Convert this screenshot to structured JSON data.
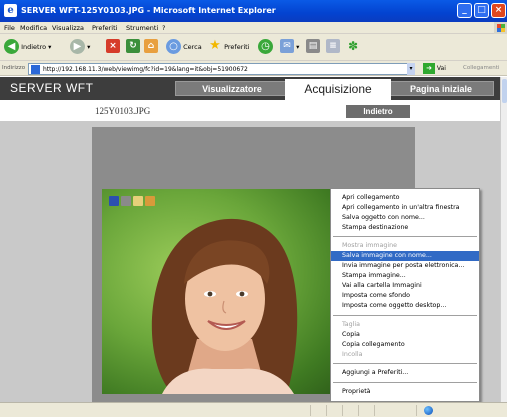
{
  "window": {
    "title": "SERVER WFT-125Y0103.JPG - Microsoft Internet Explorer",
    "controls": {
      "minimize": "_",
      "maximize": "□",
      "close": "×"
    }
  },
  "menubar": [
    "File",
    "Modifica",
    "Visualizza",
    "Preferiti",
    "Strumenti",
    "?"
  ],
  "toolbar": {
    "back_label": "Indietro",
    "search_label": "Cerca",
    "favorites_label": "Preferiti"
  },
  "address": {
    "label": "Indirizzo",
    "url": "http://192.168.11.3/web/viewimg/fc?id=19&lang=it&obj=51900672",
    "go_label": "Vai",
    "links_label": "Collegamenti"
  },
  "page": {
    "brand": "SERVER WFT",
    "nav": {
      "viewer": "Visualizzatore",
      "acquisition": "Acquisizione",
      "home": "Pagina iniziale"
    },
    "filename": "125Y0103.JPG",
    "back_button": "Indietro"
  },
  "context_menu": {
    "items": [
      {
        "label": "Apri collegamento",
        "state": "normal"
      },
      {
        "label": "Apri collegamento in un'altra finestra",
        "state": "normal"
      },
      {
        "label": "Salva oggetto con nome...",
        "state": "normal"
      },
      {
        "label": "Stampa destinazione",
        "state": "normal"
      },
      {
        "label": "Mostra immagine",
        "state": "disabled"
      },
      {
        "label": "Salva immagine con nome...",
        "state": "selected"
      },
      {
        "label": "Invia immagine per posta elettronica...",
        "state": "normal"
      },
      {
        "label": "Stampa immagine...",
        "state": "normal"
      },
      {
        "label": "Vai alla cartella Immagini",
        "state": "normal"
      },
      {
        "label": "Imposta come sfondo",
        "state": "normal"
      },
      {
        "label": "Imposta come oggetto desktop...",
        "state": "normal"
      },
      {
        "label": "Taglia",
        "state": "disabled"
      },
      {
        "label": "Copia",
        "state": "normal"
      },
      {
        "label": "Copia collegamento",
        "state": "normal"
      },
      {
        "label": "Incolla",
        "state": "disabled"
      },
      {
        "label": "Aggiungi a Preferiti...",
        "state": "normal"
      },
      {
        "label": "Proprietà",
        "state": "normal"
      }
    ]
  },
  "colors": {
    "titlebar": "#0343d0",
    "selection": "#316ac5",
    "site_header": "#3d3d3d",
    "nav_button": "#7b7b7b"
  },
  "icons": [
    "ie-icon",
    "back-arrow-icon",
    "forward-arrow-icon",
    "stop-icon",
    "refresh-icon",
    "home-icon",
    "search-icon",
    "favorites-star-icon",
    "history-icon",
    "mail-icon",
    "print-icon",
    "messenger-icon",
    "go-arrow-icon",
    "globe-icon"
  ]
}
